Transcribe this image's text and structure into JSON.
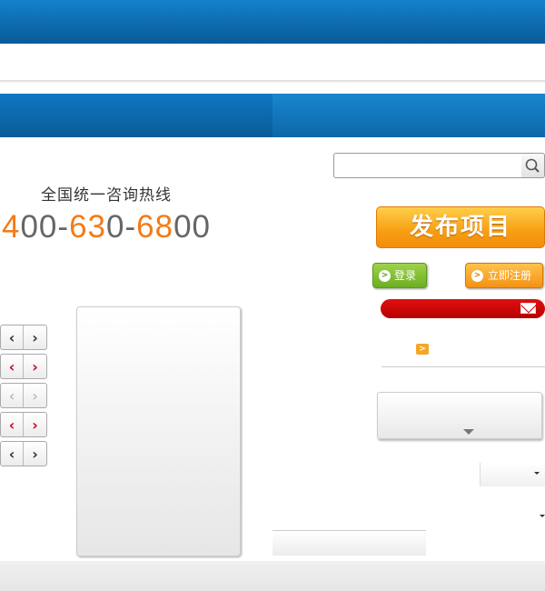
{
  "hotline": {
    "label": "全国统一咨询热线",
    "phone_parts": [
      "4",
      "00-",
      "63",
      "0-",
      "68",
      "00"
    ]
  },
  "search": {
    "placeholder": ""
  },
  "actions": {
    "publish_label": "发布项目",
    "login_label": "登录",
    "register_label": "立即注册"
  },
  "icons": {
    "search": "search-icon",
    "mail": "mail-icon",
    "arrow": "chevron-right-icon",
    "pager_prev": "chevron-left-icon",
    "pager_next": "chevron-right-icon"
  },
  "pager_glyphs": {
    "prev": "‹",
    "next": "›"
  },
  "colors": {
    "header_blue": "#0a5a98",
    "accent_orange": "#f47b16",
    "login_green": "#6cae22",
    "alert_red": "#c00000"
  }
}
